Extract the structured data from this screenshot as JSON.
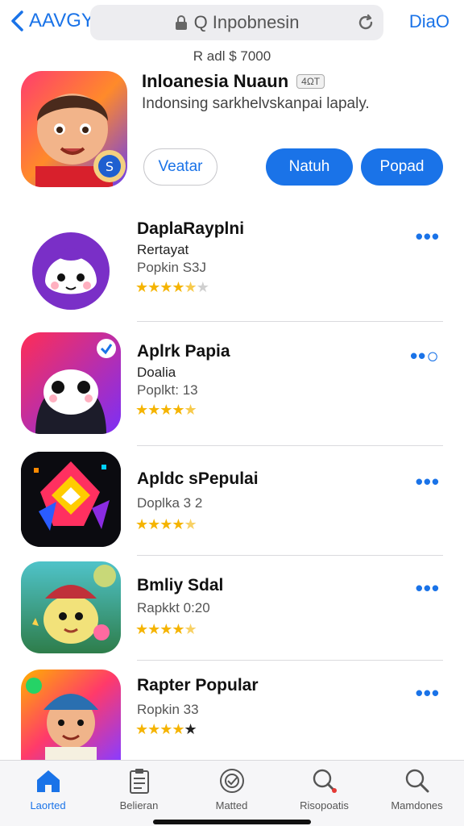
{
  "nav": {
    "back_label": "AAVGY",
    "url_text": "Q Inpobnesin",
    "done_label": "DiaO"
  },
  "subtitle": "R adl $ 7000",
  "featured": {
    "title": "Inloanesia Nuaun",
    "age_badge": "4ΩT",
    "description": "Indonsing sarkhelvskanpai lapaly.",
    "btn_outline": "Veatar",
    "btn_primary_a": "Natuh",
    "btn_primary_b": "Popad"
  },
  "apps": [
    {
      "name": "DaplaRayplni",
      "developer": "Rertayat",
      "meta": "Popkin S3J",
      "rating": 4.5,
      "more": "•••"
    },
    {
      "name": "Aplrk Papia",
      "developer": "Doalia",
      "meta": "Poplkt: 13",
      "rating": 4.5,
      "more": "••○"
    },
    {
      "name": "Apldc sPepulai",
      "developer": "",
      "meta": "Doplka 3 2",
      "rating": 4.5,
      "more": "•••"
    },
    {
      "name": "Bmliy Sdal",
      "developer": "",
      "meta": "Rapkkt 0:20",
      "rating": 4.5,
      "more": "•••"
    },
    {
      "name": "Rapter Popular",
      "developer": "",
      "meta": "Ropkin 33",
      "rating": 4.5,
      "more": "•••"
    }
  ],
  "tabs": [
    {
      "label": "Laorted",
      "icon": "home-icon",
      "active": true
    },
    {
      "label": "Belieran",
      "icon": "clipboard-icon",
      "active": false
    },
    {
      "label": "Matted",
      "icon": "badge-icon",
      "active": false
    },
    {
      "label": "Risopoatis",
      "icon": "search-alert-icon",
      "active": false
    },
    {
      "label": "Mamdones",
      "icon": "search-icon",
      "active": false
    }
  ],
  "colors": {
    "accent": "#1a73e8",
    "star": "#f5b400"
  }
}
